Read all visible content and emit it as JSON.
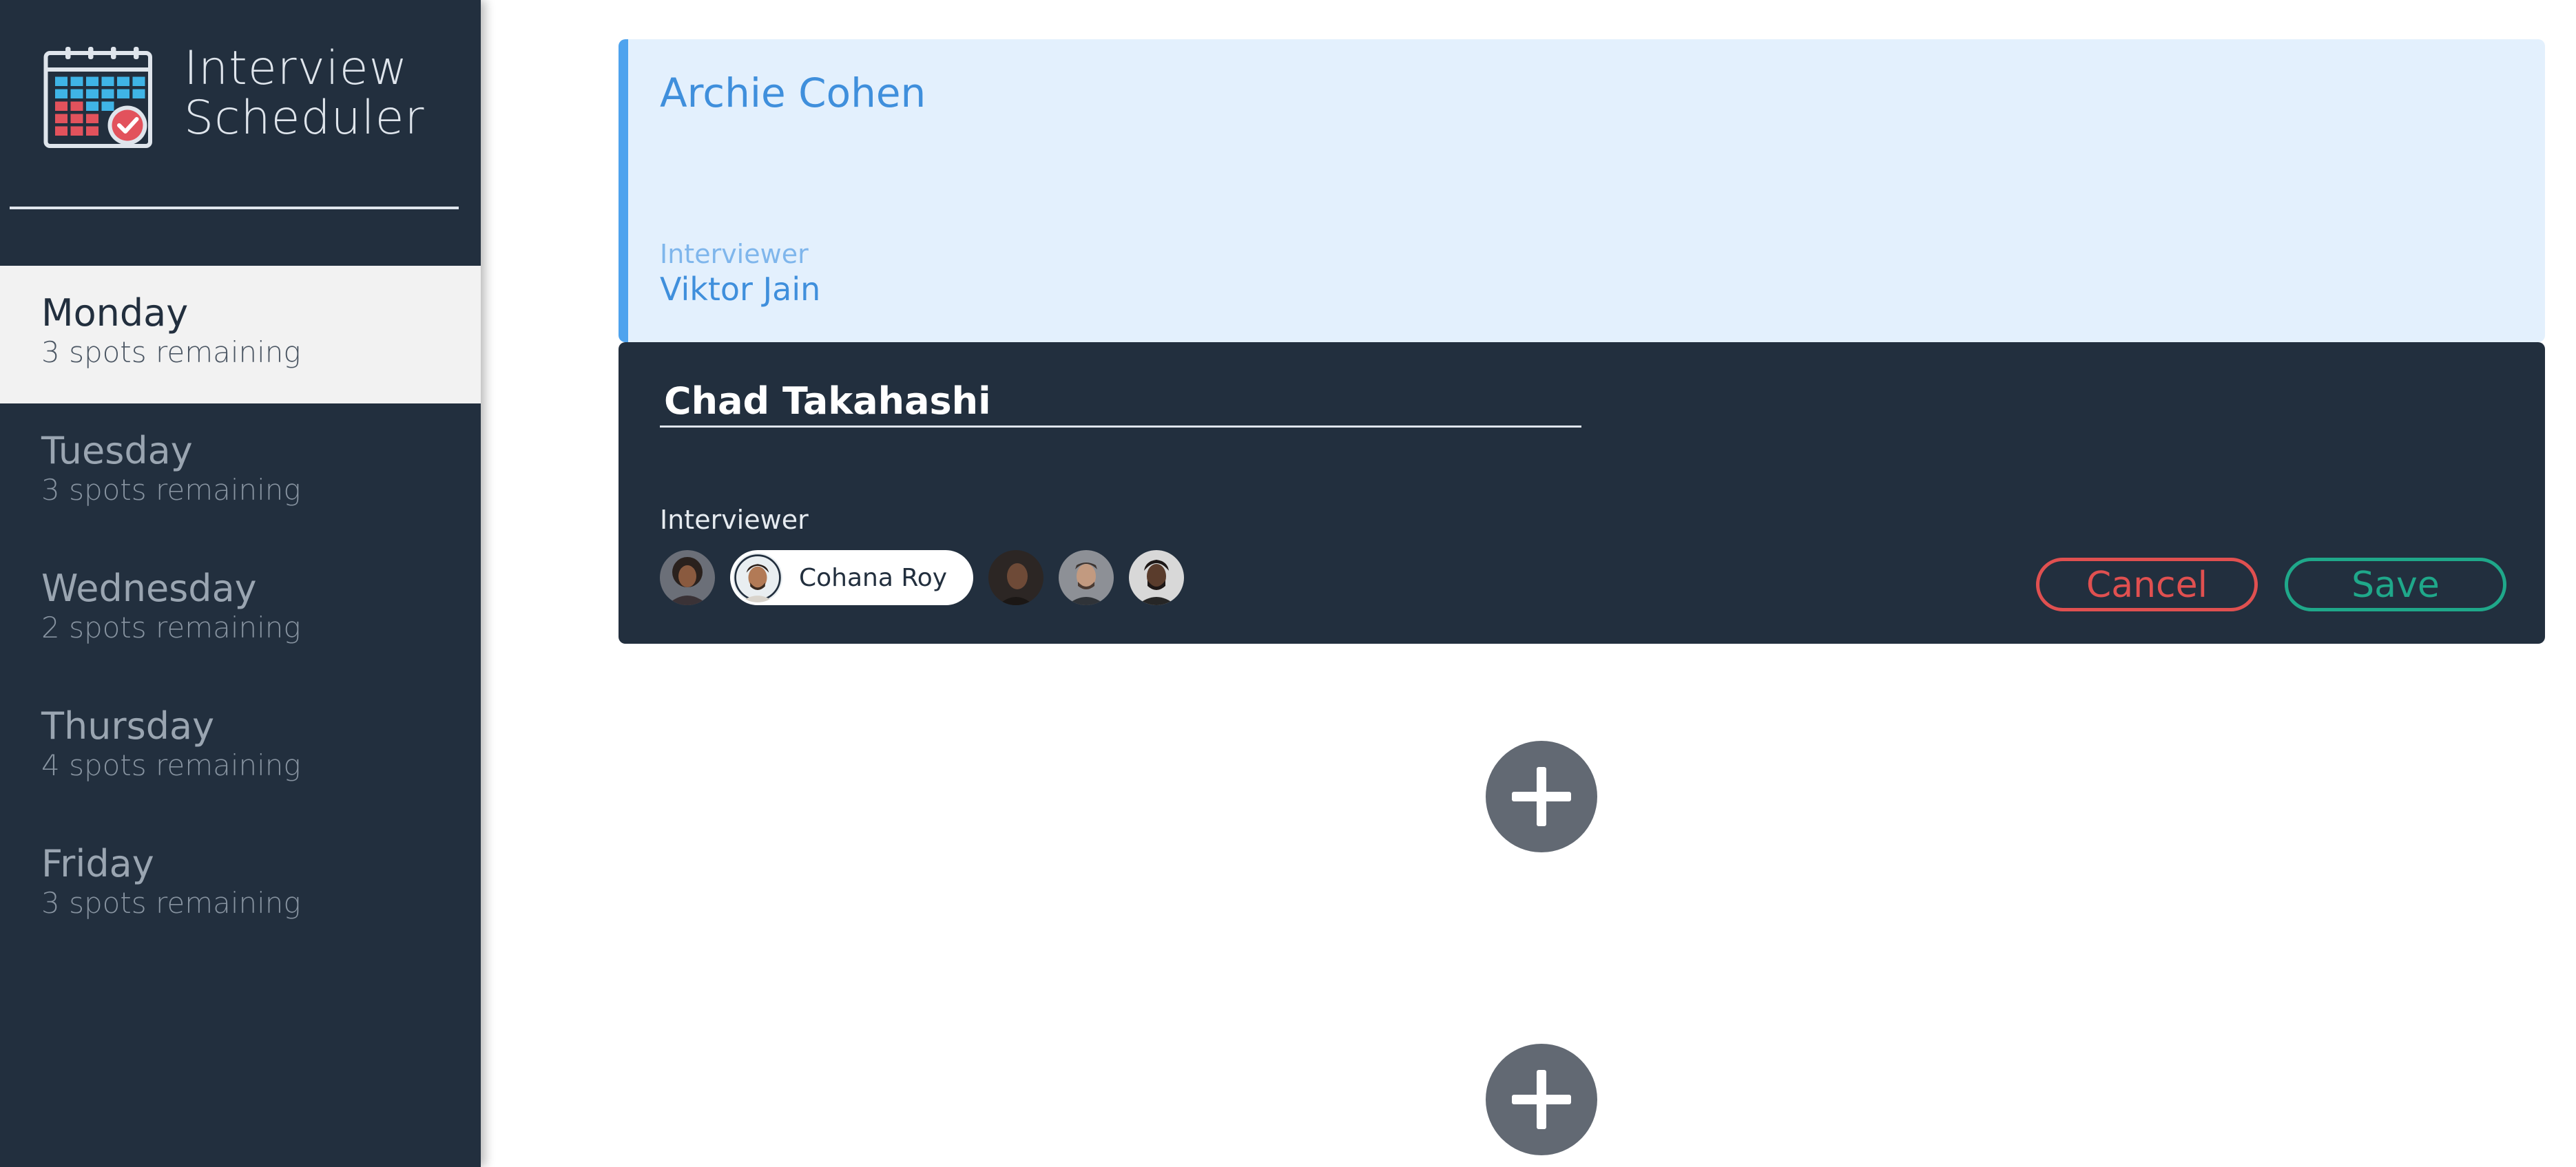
{
  "app": {
    "title_line1": "Interview",
    "title_line2": "Scheduler",
    "logo_icon": "calendar-check-icon"
  },
  "days": [
    {
      "name": "Monday",
      "spots": "3 spots remaining",
      "selected": true
    },
    {
      "name": "Tuesday",
      "spots": "3 spots remaining",
      "selected": false
    },
    {
      "name": "Wednesday",
      "spots": "2 spots remaining",
      "selected": false
    },
    {
      "name": "Thursday",
      "spots": "4 spots remaining",
      "selected": false
    },
    {
      "name": "Friday",
      "spots": "3 spots remaining",
      "selected": false
    }
  ],
  "appointment": {
    "student": "Archie Cohen",
    "interviewer_label": "Interviewer",
    "interviewer_name": "Viktor Jain"
  },
  "form": {
    "student_value": "Chad Takahashi",
    "interviewer_label": "Interviewer",
    "selected_interviewer": "Cohana Roy",
    "cancel_label": "Cancel",
    "save_label": "Save"
  },
  "add_icon": "plus-icon",
  "colors": {
    "sidebar_bg": "#222f3e",
    "show_bg": "#e3f0fd",
    "accent_blue": "#4ea3ee",
    "danger": "#e05050",
    "success": "#1fa88a",
    "add_bg": "#626973"
  }
}
